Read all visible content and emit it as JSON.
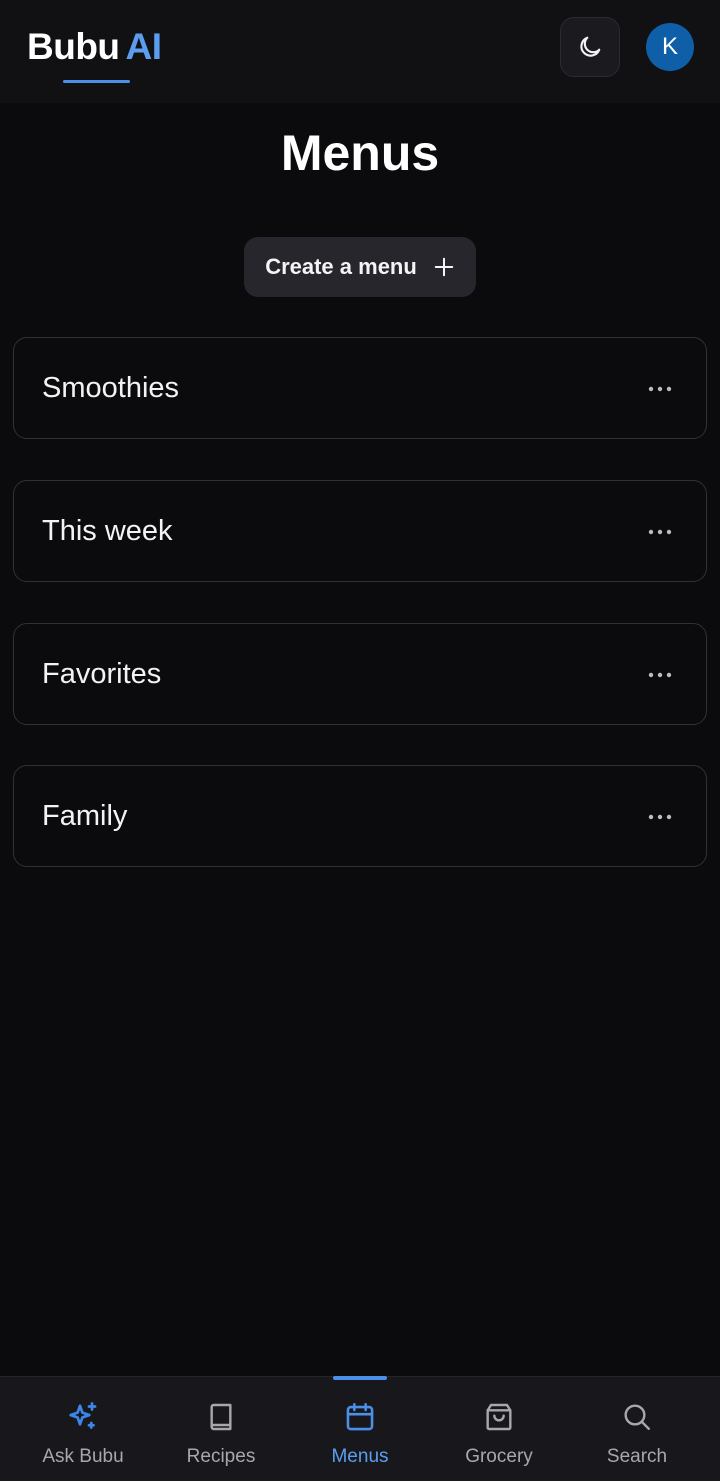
{
  "header": {
    "brand_main": "Bubu",
    "brand_accent": "AI",
    "avatar_initial": "K",
    "theme_icon": "moon-icon"
  },
  "page": {
    "title": "Menus",
    "create_button_label": "Create a menu",
    "create_icon": "plus-icon"
  },
  "menus": [
    {
      "name": "Smoothies"
    },
    {
      "name": "This week"
    },
    {
      "name": "Favorites"
    },
    {
      "name": "Family"
    }
  ],
  "bottom_nav": {
    "active": "Menus",
    "items": [
      {
        "label": "Ask Bubu",
        "icon": "sparkles-icon"
      },
      {
        "label": "Recipes",
        "icon": "book-icon"
      },
      {
        "label": "Menus",
        "icon": "calendar-icon"
      },
      {
        "label": "Grocery",
        "icon": "shopping-bag-icon"
      },
      {
        "label": "Search",
        "icon": "search-icon"
      }
    ]
  },
  "colors": {
    "background": "#0b0b0e",
    "accent": "#5b9ef0",
    "avatar": "#0f5fa8"
  }
}
